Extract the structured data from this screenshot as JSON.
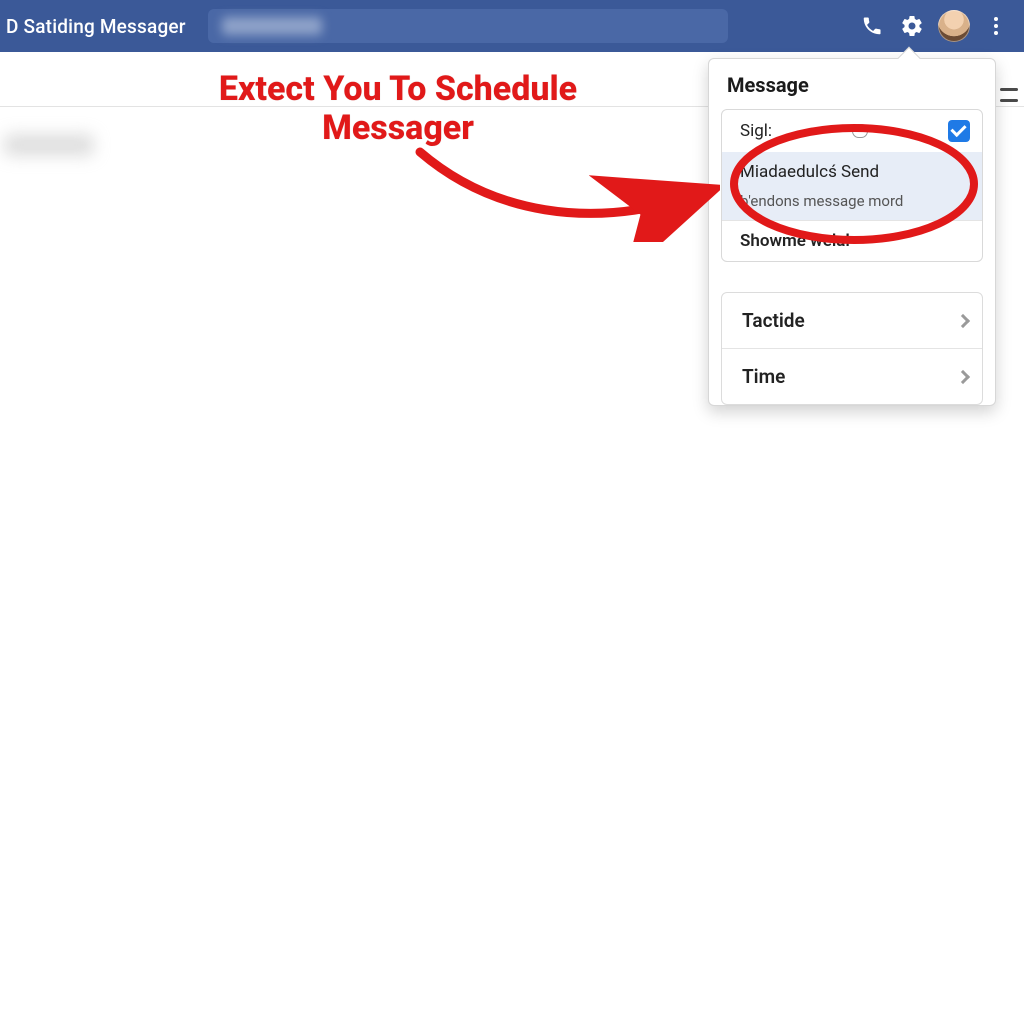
{
  "topbar": {
    "title": "D Satiding Messager",
    "search_placeholder": " ",
    "icons": {
      "phone": "phone-icon",
      "gear": "gear-icon",
      "kebab": "more-icon"
    }
  },
  "annotation": {
    "text": "Extect You To Schedule Messager",
    "color": "#e11919"
  },
  "panel": {
    "header": "Message",
    "card": {
      "first_row_text": "Sigl:",
      "first_row_checked": true,
      "scheduled_send": "Miadaedulcś Send",
      "scheduled_send_sub": "b'endons message mord",
      "show_me": "Showme welal"
    },
    "list": [
      {
        "label": "Tactide"
      },
      {
        "label": "Time"
      }
    ]
  }
}
